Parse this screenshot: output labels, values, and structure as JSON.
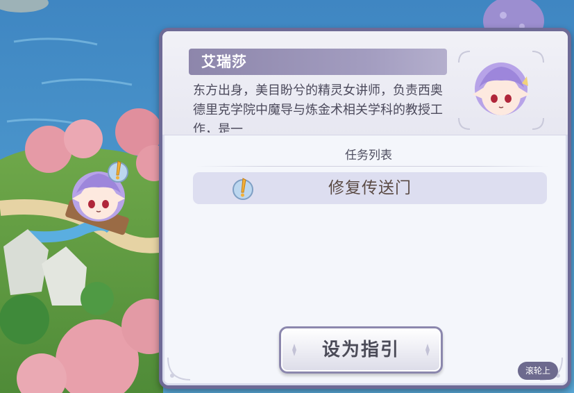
{
  "npc": {
    "name": "艾瑞莎",
    "description": "东方出身，美目盼兮的精灵女讲师，负责西奥德里克学院中魔导与炼金术相关学科的教授工作，是一"
  },
  "task_list": {
    "title": "任务列表",
    "items": [
      {
        "label": "修复传送门",
        "icon": "quest-exclamation-icon"
      }
    ]
  },
  "guide_button": {
    "label": "设为指引"
  },
  "scroll_hint": {
    "label": "滚轮上"
  },
  "colors": {
    "panel_border": "#6e6a96",
    "name_plate": "#8d86ab",
    "task_item_bg": "#dddef0",
    "quest_icon": "#f2b13a"
  }
}
